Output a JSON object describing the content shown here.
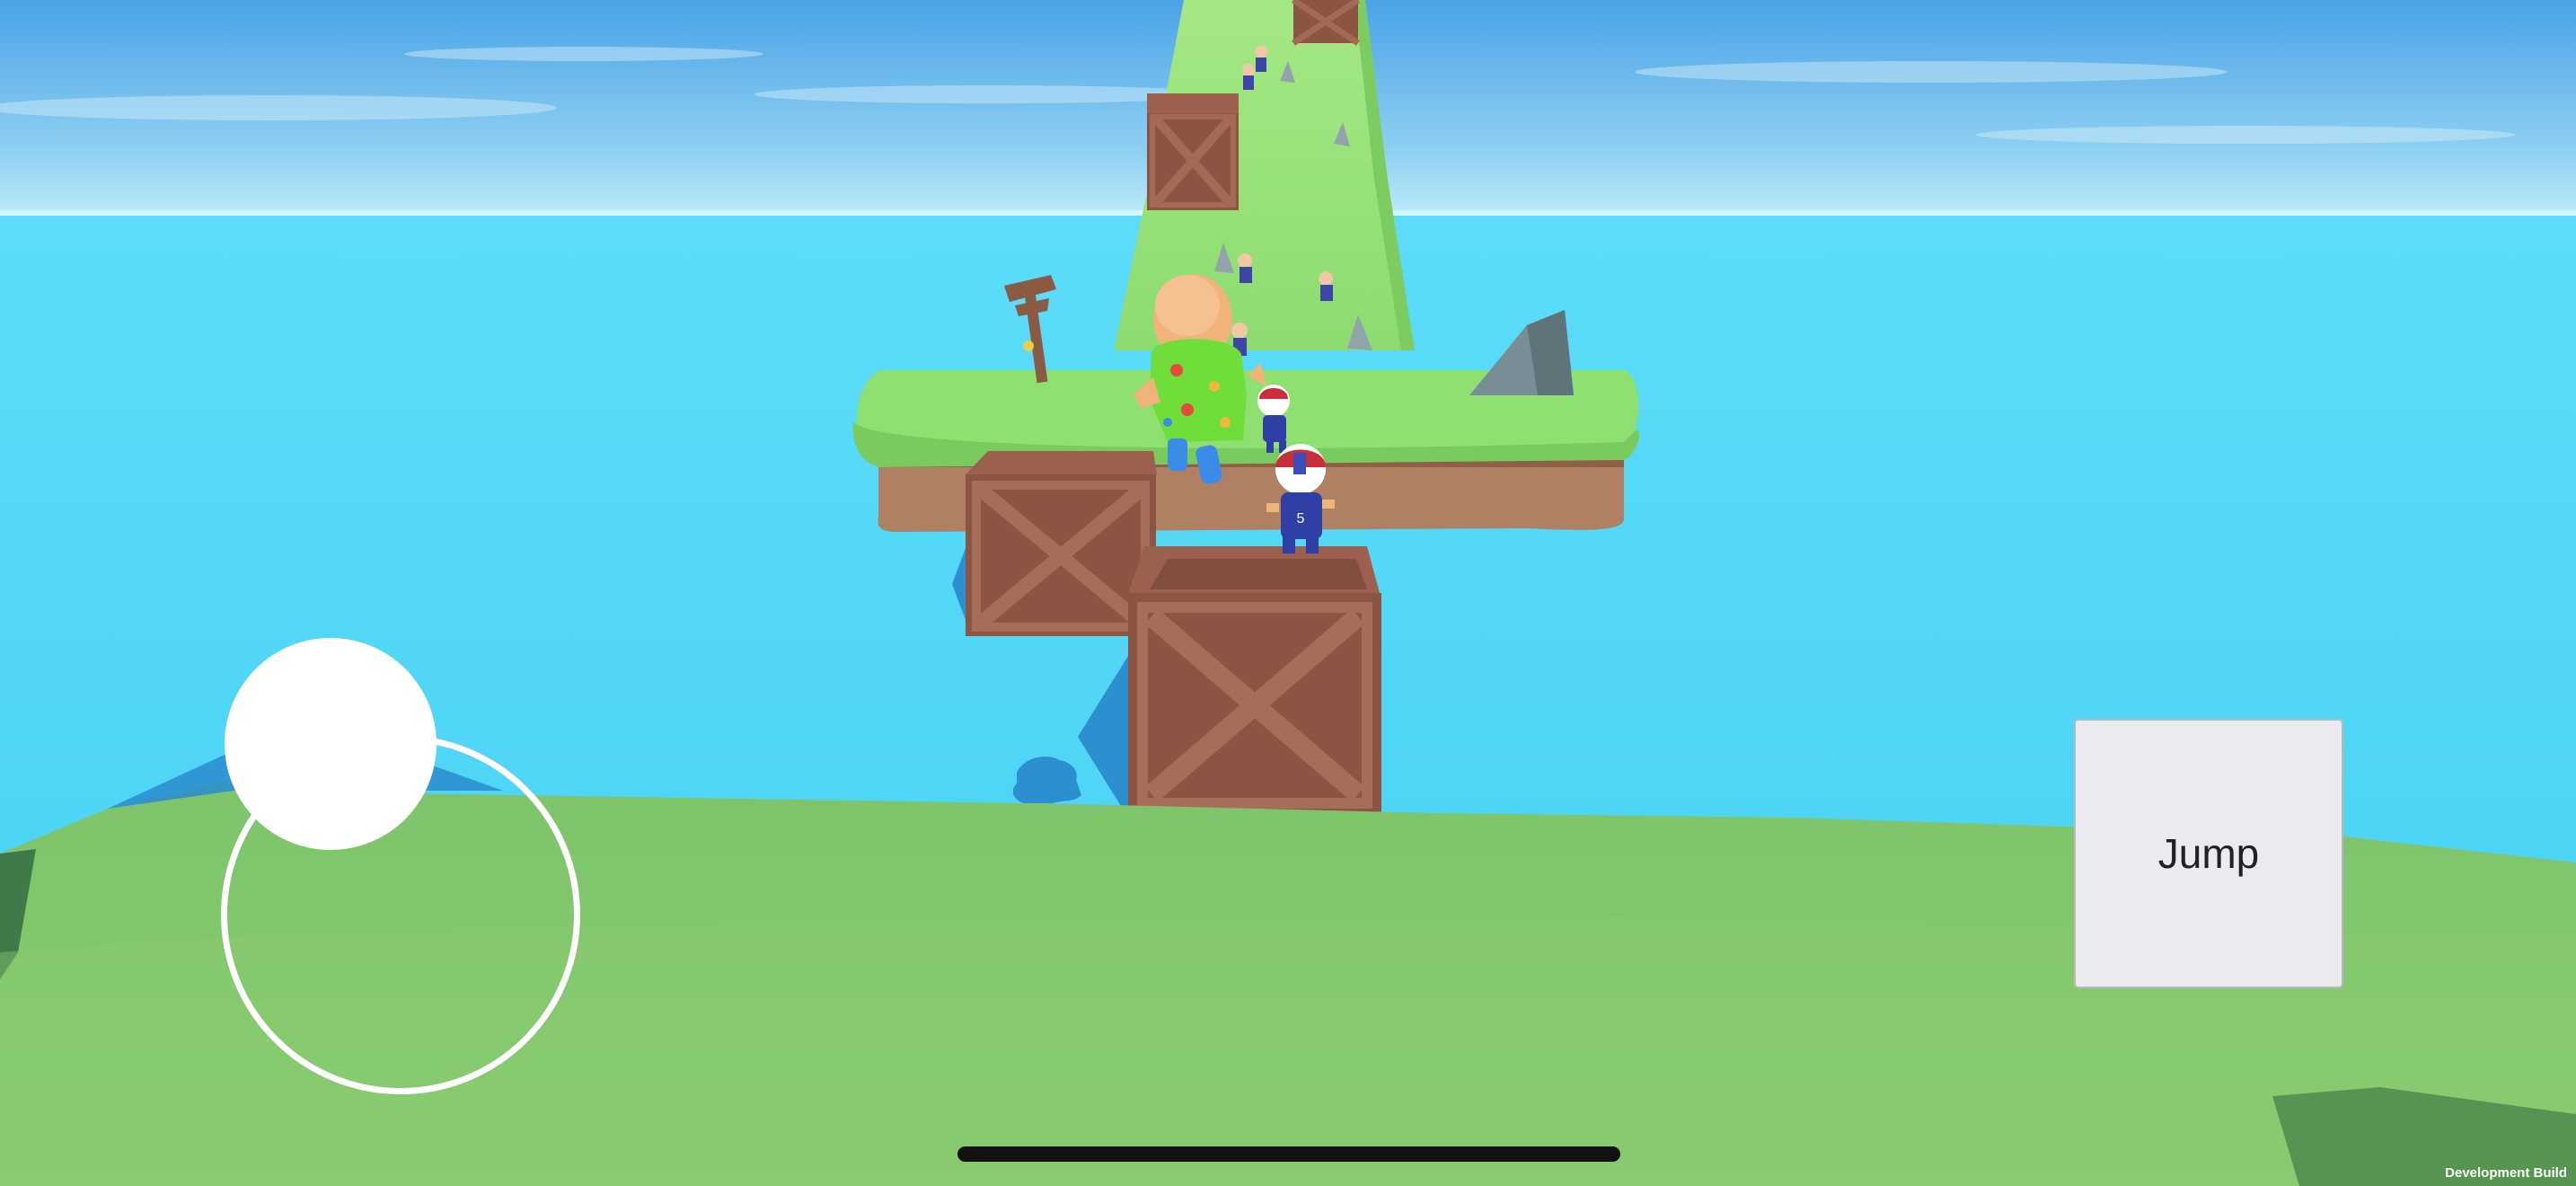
{
  "controls": {
    "jump_label": "Jump"
  },
  "footer": {
    "build_label": "Development Build"
  },
  "colors": {
    "sky_top": "#4aa3e6",
    "sky_horizon": "#bdeaf8",
    "water": "#4fd6f5",
    "grass": "#86c96f",
    "crate": "#8b5443",
    "jump_button_bg": "#ebeaee"
  },
  "icons": {
    "joystick": "virtual-joystick",
    "signpost": "wooden-signpost",
    "rock": "grey-rock"
  }
}
